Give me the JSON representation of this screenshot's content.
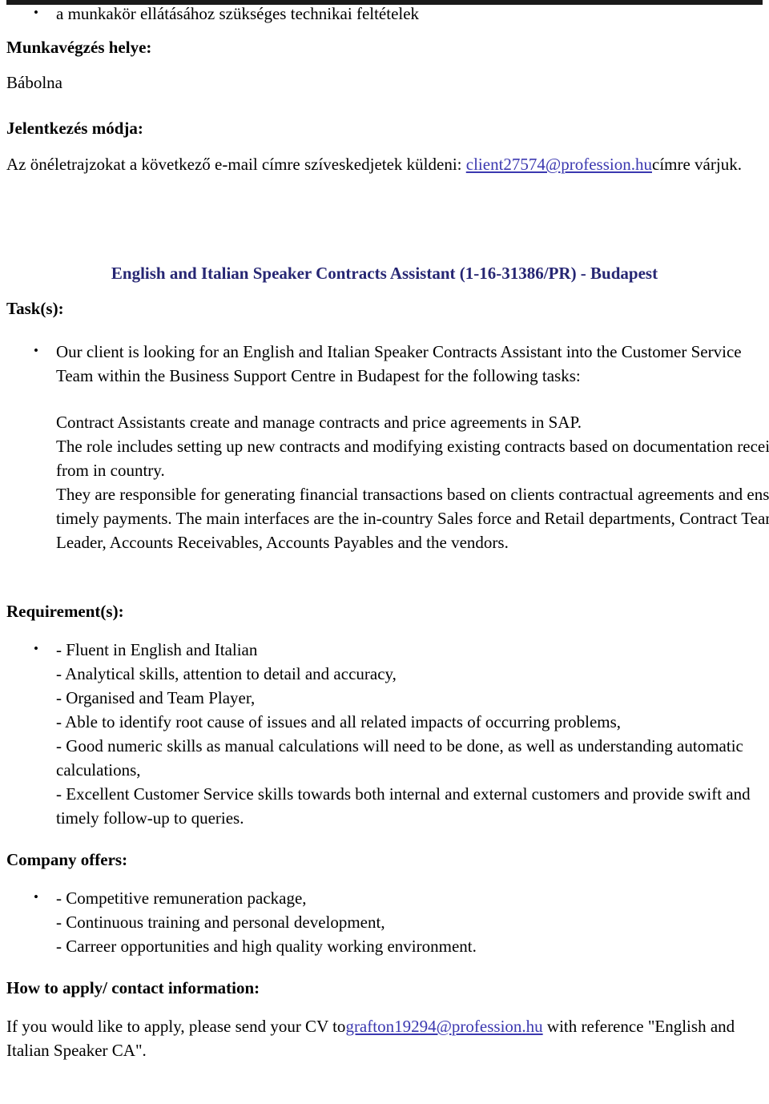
{
  "document": {
    "top_bullet": "a munkakör ellátásához szükséges technikai feltételek",
    "work_place_heading": "Munkavégzés helye:",
    "work_place_value": "Bábolna",
    "apply_mode_heading": "Jelentkezés módja:",
    "apply_mode_text_before": "Az önéletrajzokat a következő e-mail címre szíveskedjetek küldeni: ",
    "apply_mode_email": "client27574@profession.hu",
    "apply_mode_text_after": "címre várjuk.",
    "job_title": "English and Italian Speaker Contracts Assistant (1-16-31386/PR) - Budapest",
    "tasks_heading": "Task(s):",
    "tasks_bullet": "Our client is looking for an English and Italian Speaker Contracts Assistant into the Customer Service Team within the Business Support Centre in Budapest for the following tasks:",
    "tasks_detail_lines": [
      "Contract Assistants create and manage contracts and price agreements in SAP.",
      "The role includes setting up new contracts and modifying existing contracts based on documentation received from in country.",
      "They are responsible for generating financial transactions based on clients contractual agreements and ensuring timely payments. The main interfaces are the in-country Sales force and Retail departments, Contract Team Leader, Accounts Receivables, Accounts Payables and the vendors."
    ],
    "requirements_heading": "Requirement(s):",
    "requirements_first": "- Fluent in English and Italian",
    "requirements_rest": [
      "- Analytical skills, attention to detail and accuracy,",
      "- Organised and Team Player,",
      "- Able to identify root cause of issues and all related impacts of occurring problems,",
      "- Good numeric skills as manual calculations will need to be done, as well as understanding automatic calculations,",
      "- Excellent Customer Service skills towards both internal and external customers and provide swift and timely follow-up to queries."
    ],
    "offers_heading": "Company offers:",
    "offers_first": "- Competitive remuneration package,",
    "offers_rest": [
      "- Continuous training and personal development,",
      "- Carreer opportunities and high quality working environment."
    ],
    "apply_heading": "How to apply/ contact information:",
    "apply_text_before": "If you would like to apply, please send your CV to",
    "apply_email": "grafton19294@profession.hu",
    "apply_text_after": " with reference \"English and Italian Speaker CA\".",
    "colors": {
      "title": "#262673",
      "link": "#3b38b0",
      "text": "#000000",
      "rule": "#1a1a1a",
      "background": "#ffffff"
    }
  }
}
